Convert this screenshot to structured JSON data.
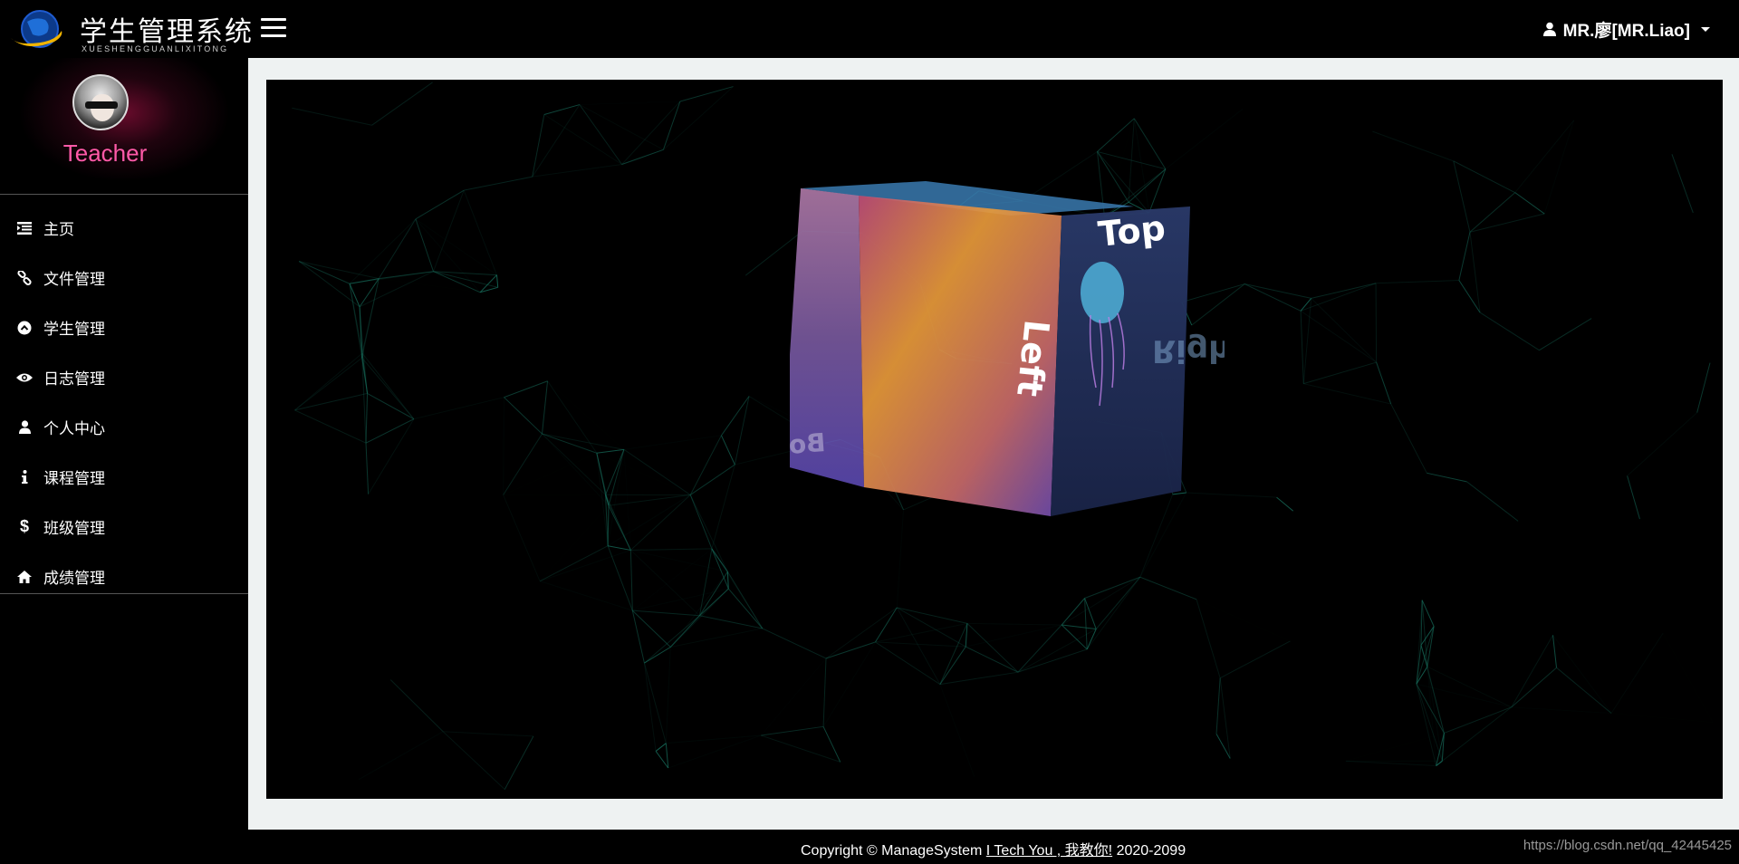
{
  "header": {
    "logo_title": "学生管理系统",
    "logo_subtitle": "XUESHENGGUANLIXITONG",
    "user_name": "MR.廖[MR.Liao]"
  },
  "sidebar": {
    "role": "Teacher",
    "items": [
      {
        "label": "主页",
        "icon": "list-icon"
      },
      {
        "label": "文件管理",
        "icon": "link-icon"
      },
      {
        "label": "学生管理",
        "icon": "chevron-circle-up-icon"
      },
      {
        "label": "日志管理",
        "icon": "eye-icon"
      },
      {
        "label": "个人中心",
        "icon": "user-icon"
      },
      {
        "label": "课程管理",
        "icon": "info-icon"
      },
      {
        "label": "班级管理",
        "icon": "dollar-icon"
      },
      {
        "label": "成绩管理",
        "icon": "home-icon"
      }
    ]
  },
  "cube": {
    "faces": [
      "Top",
      "Left",
      "Right",
      "Bottom"
    ]
  },
  "footer": {
    "copyright_prefix": "Copyright © ManageSystem",
    "link_text": "I Tech You , 我教你!",
    "years": "2020-2099",
    "watermark": "https://blog.csdn.net/qq_42445425"
  },
  "colors": {
    "accent_pink": "#ff5aa8",
    "network_line": "#1e8f78",
    "frame_bg": "#eef2f2"
  }
}
